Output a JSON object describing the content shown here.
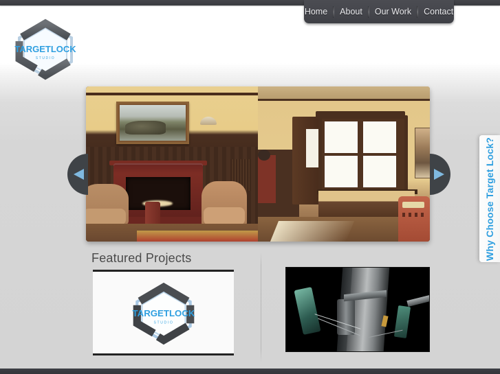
{
  "site": {
    "brand_name": "TARGETLOCK",
    "brand_sub": "STUDIO",
    "accent_color": "#2f9fe0",
    "nav_bg_color": "#45464c",
    "page_bg_color": "#d6d6d6"
  },
  "nav": {
    "items": [
      {
        "label": "Home"
      },
      {
        "label": "About"
      },
      {
        "label": "Our Work"
      },
      {
        "label": "Contact"
      }
    ]
  },
  "carousel": {
    "prev_icon": "left-triangle-arrow-icon",
    "next_icon": "right-triangle-arrow-icon",
    "slide_alt": "Interior architectural render of a lounge with fireplace, armchairs, framed landscape painting, wood wainscot panelling, tall bright windows, wooden bench and vintage radio"
  },
  "side_tab": {
    "label": "Why Choose Target Lock?"
  },
  "featured": {
    "heading": "Featured Projects",
    "projects": [
      {
        "name": "TargetLock Studio logo reel",
        "thumb_alt": "White card with the TargetLock Studio hexagon logo"
      },
      {
        "name": "Space station render",
        "thumb_alt": "Dark sci-fi render of a metallic space station pylon with green spacecraft"
      }
    ]
  }
}
